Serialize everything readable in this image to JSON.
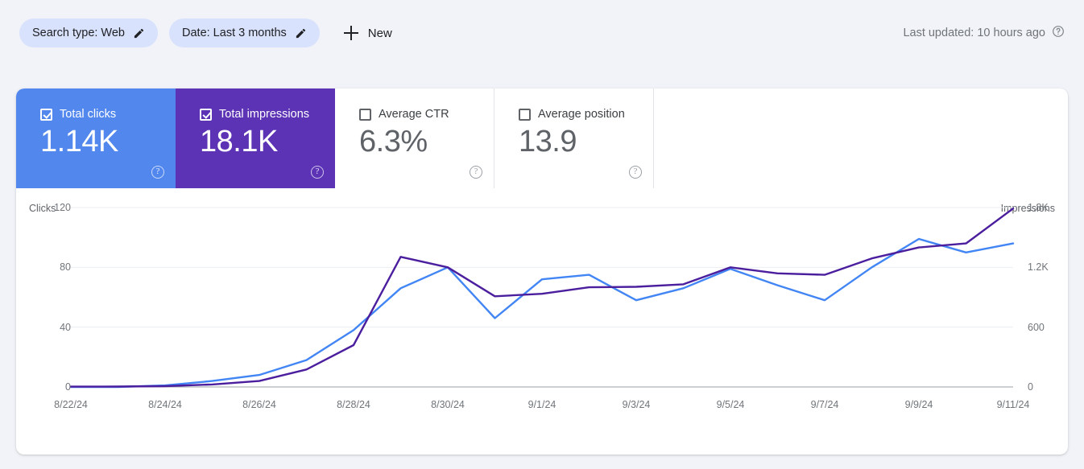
{
  "toolbar": {
    "chips": [
      {
        "label": "Search type: Web",
        "icon": "pencil-icon"
      },
      {
        "label": "Date: Last 3 months",
        "icon": "pencil-icon"
      }
    ],
    "new_button": "New",
    "last_updated": "Last updated: 10 hours ago"
  },
  "metrics": [
    {
      "label": "Total clicks",
      "value": "1.14K",
      "checked": true,
      "state": "active-blue",
      "color": "#5287ed"
    },
    {
      "label": "Total impressions",
      "value": "18.1K",
      "checked": true,
      "state": "active-purple",
      "color": "#5c33b5"
    },
    {
      "label": "Average CTR",
      "value": "6.3%",
      "checked": false,
      "state": "inactive",
      "color": "#ffffff"
    },
    {
      "label": "Average position",
      "value": "13.9",
      "checked": false,
      "state": "inactive",
      "color": "#ffffff"
    }
  ],
  "chart_data": {
    "type": "line",
    "title": "",
    "xlabel": "",
    "ylabel": "Clicks",
    "y2label": "Impressions",
    "grid": true,
    "legend": "none",
    "x": [
      "8/22/24",
      "8/23/24",
      "8/24/24",
      "8/25/24",
      "8/26/24",
      "8/27/24",
      "8/28/24",
      "8/29/24",
      "8/30/24",
      "8/31/24",
      "9/1/24",
      "9/2/24",
      "9/3/24",
      "9/4/24",
      "9/5/24",
      "9/6/24",
      "9/7/24",
      "9/8/24",
      "9/9/24",
      "9/10/24",
      "9/11/24"
    ],
    "xtick_labels": [
      "8/22/24",
      "8/24/24",
      "8/26/24",
      "8/28/24",
      "8/30/24",
      "9/1/24",
      "9/3/24",
      "9/5/24",
      "9/7/24",
      "9/9/24",
      "9/11/24"
    ],
    "yticks_left": [
      "0",
      "40",
      "80",
      "120"
    ],
    "yticks_right": [
      "0",
      "600",
      "1.2K",
      "1.8K"
    ],
    "ylim": [
      0,
      120
    ],
    "y2lim": [
      0,
      1800
    ],
    "series": [
      {
        "name": "Clicks",
        "color": "#4285f4",
        "axis": "left",
        "values": [
          0,
          0,
          1,
          4,
          8,
          18,
          38,
          66,
          80,
          46,
          72,
          75,
          58,
          66,
          79,
          68,
          58,
          80,
          99,
          90,
          96
        ]
      },
      {
        "name": "Impressions",
        "color": "#4b1e9e",
        "axis": "right",
        "values": [
          3,
          4,
          8,
          25,
          60,
          175,
          420,
          1305,
          1200,
          910,
          935,
          1000,
          1005,
          1030,
          1200,
          1140,
          1125,
          1290,
          1400,
          1440,
          1790
        ]
      }
    ]
  }
}
